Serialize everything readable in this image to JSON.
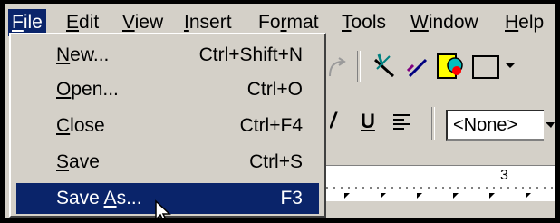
{
  "menubar": {
    "items": [
      {
        "label": "File",
        "ul": "F",
        "rest": "ile",
        "active": true
      },
      {
        "label": "Edit",
        "ul": "E",
        "rest": "dit"
      },
      {
        "label": "View",
        "ul": "V",
        "rest": "iew"
      },
      {
        "label": "Insert",
        "ul": "I",
        "rest": "nsert"
      },
      {
        "label": "Format",
        "pre": "Fo",
        "ul": "r",
        "rest": "mat"
      },
      {
        "label": "Tools",
        "ul": "T",
        "rest": "ools"
      },
      {
        "label": "Window",
        "ul": "W",
        "rest": "indow"
      },
      {
        "label": "Help",
        "ul": "H",
        "rest": "elp"
      }
    ]
  },
  "file_menu": {
    "items": [
      {
        "pre": "",
        "ul": "N",
        "rest": "ew...",
        "shortcut": "Ctrl+Shift+N"
      },
      {
        "pre": "",
        "ul": "O",
        "rest": "pen...",
        "shortcut": "Ctrl+O"
      },
      {
        "pre": "",
        "ul": "C",
        "rest": "lose",
        "shortcut": "Ctrl+F4"
      },
      {
        "pre": "",
        "ul": "S",
        "rest": "ave",
        "shortcut": "Ctrl+S"
      },
      {
        "pre": "Save ",
        "ul": "A",
        "rest": "s...",
        "shortcut": "F3",
        "selected": true
      }
    ]
  },
  "formatting_toolbar": {
    "underline_label": "U",
    "style_value": "<None>"
  },
  "ruler": {
    "mark_label": "3"
  }
}
